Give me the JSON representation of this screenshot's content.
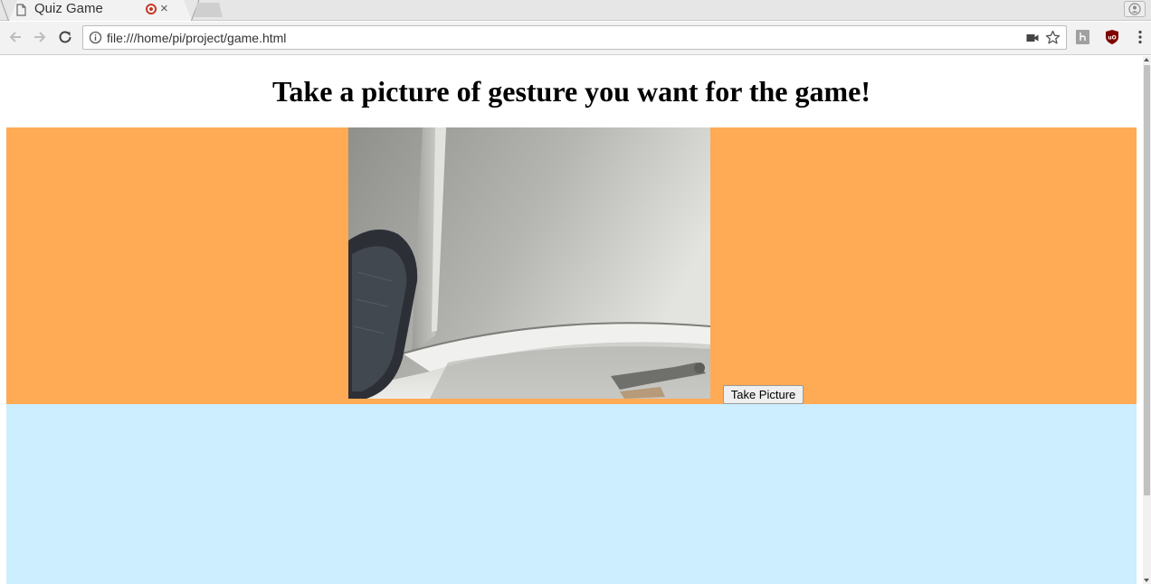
{
  "tab": {
    "title": "Quiz Game",
    "close_glyph": "×",
    "page_icon": "document-icon",
    "status_icon": "recording-icon"
  },
  "toolbar": {
    "back_icon": "back-arrow-icon",
    "forward_icon": "forward-arrow-icon",
    "reload_icon": "reload-icon",
    "url": "file:///home/pi/project/game.html",
    "extensions": [
      "hypothesis-extension-icon",
      "ublock-extension-icon"
    ],
    "menu_icon": "kebab-menu-icon"
  },
  "page": {
    "heading": "Take a picture of gesture you want for the game!",
    "button_label": "Take Picture",
    "colors": {
      "orange_section": "#ffaa55",
      "blue_section": "#cceeff"
    }
  }
}
